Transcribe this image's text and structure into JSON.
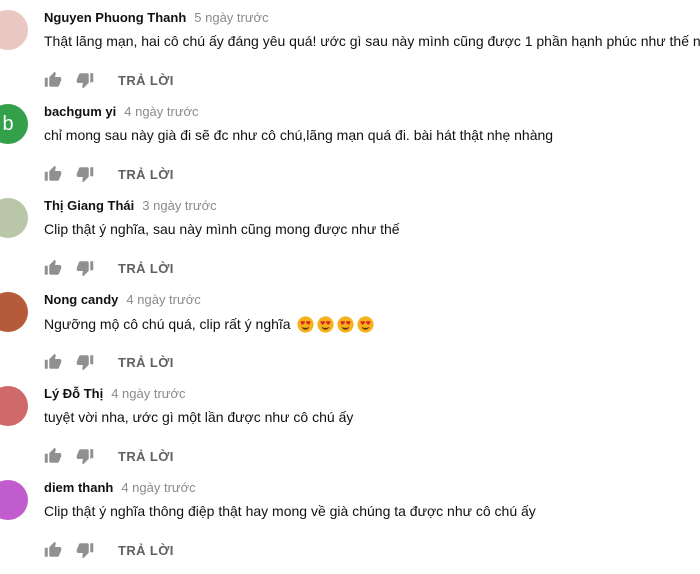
{
  "comments": [
    {
      "author": "Nguyen Phuong Thanh",
      "time": "5 ngày trước",
      "text": "Thật lãng mạn, hai cô chú ấy đáng yêu quá! ước gì sau này mình cũng được 1 phần hạnh phúc như thế này",
      "reply_label": "TRẢ LỜI",
      "avatar_color": "#e9c7c2",
      "emoji_count": 0
    },
    {
      "author": "bachgum yi",
      "time": "4 ngày trước",
      "text": "chỉ mong sau này già đi sẽ đc như cô chú,lãng mạn quá đi. bài hát thật nhẹ nhàng",
      "reply_label": "TRẢ LỜI",
      "avatar_letter": "b",
      "avatar_color": "#33a04a",
      "emoji_count": 0
    },
    {
      "author": "Thị Giang Thái",
      "time": "3 ngày trước",
      "text": "Clip thật ý nghĩa, sau này mình cũng mong được như thế",
      "reply_label": "TRẢ LỜI",
      "avatar_color": "#b9c7a8",
      "emoji_count": 0
    },
    {
      "author": "Nong candy",
      "time": "4 ngày trước",
      "text": "Ngưỡng mộ cô chú quá, clip rất ý nghĩa",
      "reply_label": "TRẢ LỜI",
      "avatar_color": "#b55b3a",
      "emoji_count": 4
    },
    {
      "author": "Lý Đỗ Thị",
      "time": "4 ngày trước",
      "text": "tuyệt vời nha, ước gì một lần được như cô chú ấy",
      "reply_label": "TRẢ LỜI",
      "avatar_color": "#d06a6a",
      "emoji_count": 0
    },
    {
      "author": "diem thanh",
      "time": "4 ngày trước",
      "text": "Clip thật ý nghĩa thông điệp thật hay mong về già chúng ta được như cô chú ấy",
      "reply_label": "TRẢ LỜI",
      "avatar_color": "#c05ccd",
      "emoji_count": 0
    }
  ],
  "colors": {
    "icon": "#909090",
    "reply": "#606060",
    "time": "#8a8a8a"
  },
  "icons": {
    "like": "thumb-up-icon",
    "dislike": "thumb-down-icon",
    "emoji": "heart-eyes-emoji-icon"
  }
}
